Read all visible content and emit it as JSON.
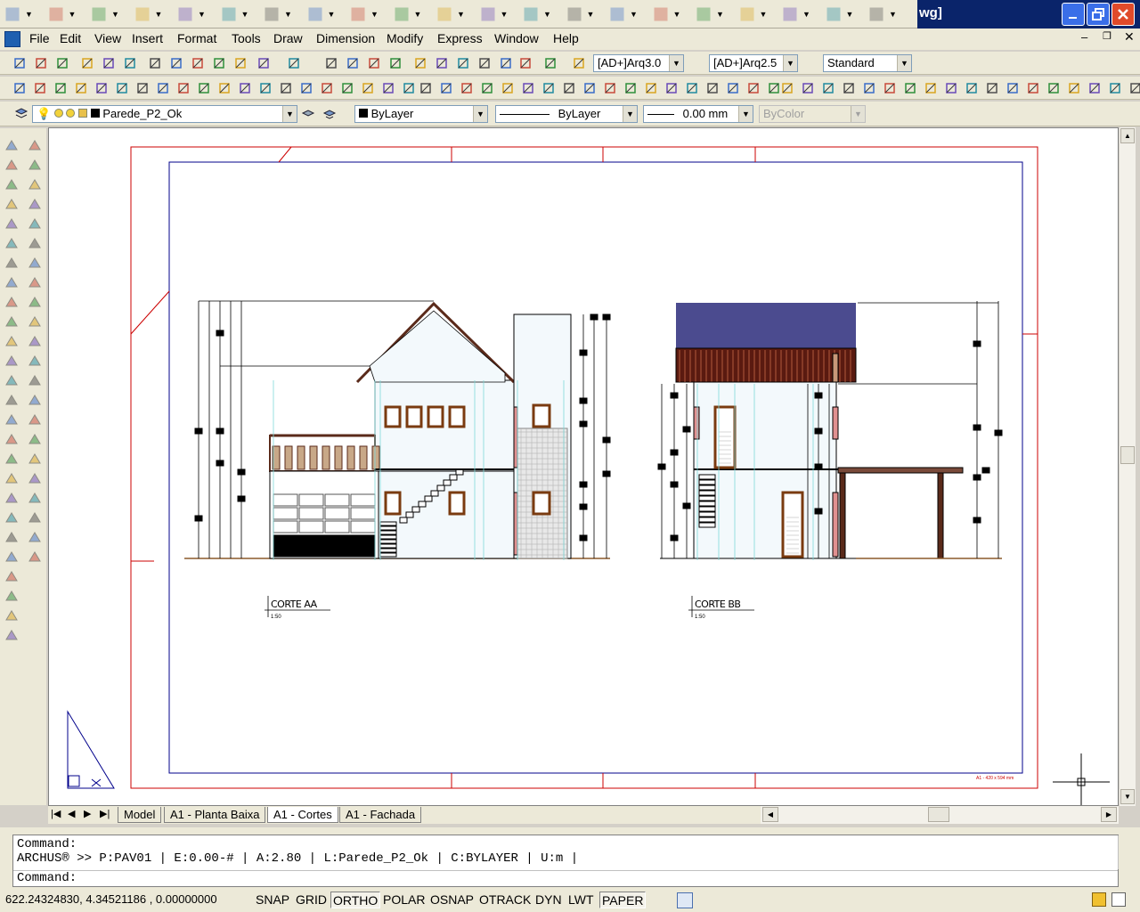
{
  "window": {
    "title_fragment": "wg]"
  },
  "menu": [
    "File",
    "Edit",
    "View",
    "Insert",
    "Format",
    "Tools",
    "Draw",
    "Dimension",
    "Modify",
    "Express",
    "Window",
    "Help"
  ],
  "styles_toolbar": {
    "text_style": "[AD+]Arq3.0",
    "dim_style": "[AD+]Arq2.5",
    "table_style": "Standard"
  },
  "layers_toolbar": {
    "current_layer": "Parede_P2_Ok"
  },
  "properties_toolbar": {
    "color": "ByLayer",
    "linetype": "ByLayer",
    "lineweight": "0.00 mm",
    "plotstyle": "ByColor"
  },
  "drawing": {
    "section_a_label": "CORTE AA",
    "section_a_scale": "1:50",
    "section_b_label": "CORTE BB",
    "section_b_scale": "1:50",
    "sheet_note": "A1 - 420 x 594 mm",
    "accent_red": "#cc0000",
    "accent_blue": "#00008b",
    "roof_fill": "#4b4b8f"
  },
  "layout_tabs": [
    "Model",
    "A1 - Planta Baixa",
    "A1 - Cortes",
    "A1 - Fachada"
  ],
  "active_tab": "A1 - Cortes",
  "command": {
    "line1": "Command:",
    "line2": "ARCHUS® >> P:PAV01 | E:0.00-# | A:2.80 | L:Parede_P2_Ok | C:BYLAYER | U:m |",
    "prompt": "Command:"
  },
  "status": {
    "coords": "622.24324830, 4.34521186 , 0.00000000",
    "buttons": [
      "SNAP",
      "GRID",
      "ORTHO",
      "POLAR",
      "OSNAP",
      "OTRACK",
      "DYN",
      "LWT",
      "PAPER"
    ],
    "on_buttons": [
      "ORTHO",
      "PAPER"
    ]
  }
}
